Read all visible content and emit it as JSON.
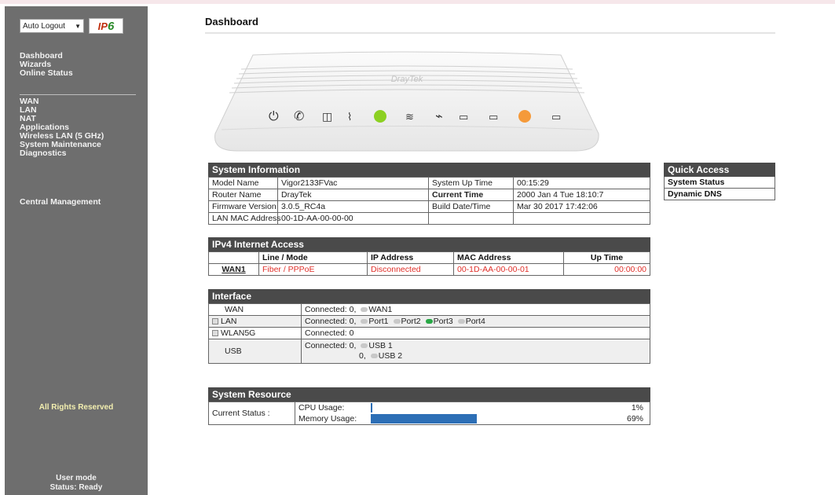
{
  "sidebar": {
    "logout_select": "Auto Logout",
    "ipv6_button": {
      "prefix": "IP",
      "suffix": "6"
    },
    "menu_group1": [
      "Dashboard",
      "Wizards",
      "Online Status"
    ],
    "menu_group2": [
      "WAN",
      "LAN",
      "NAT",
      "Applications",
      "Wireless LAN (5 GHz)",
      "System Maintenance",
      "Diagnostics"
    ],
    "central_management": "Central Management",
    "rights": "All Rights Reserved",
    "user_mode": "User mode",
    "status": "Status: Ready"
  },
  "page_title": "Dashboard",
  "router": {
    "brand_text": "DrayTek"
  },
  "system_info": {
    "title": "System Information",
    "rows": [
      [
        "Model Name",
        "Vigor2133FVac",
        "System Up Time",
        "00:15:29"
      ],
      [
        "Router Name",
        "DrayTek",
        "Current Time",
        "2000 Jan 4 Tue 18:10:7"
      ],
      [
        "Firmware Version",
        "3.0.5_RC4a",
        "Build Date/Time",
        "Mar 30 2017 17:42:06"
      ],
      [
        "LAN MAC Address",
        "00-1D-AA-00-00-00",
        "",
        ""
      ]
    ]
  },
  "quick_access": {
    "title": "Quick Access",
    "items": [
      "System Status",
      "Dynamic DNS"
    ]
  },
  "ipv4": {
    "title": "IPv4 Internet Access",
    "headers": [
      "",
      "Line / Mode",
      "IP Address",
      "MAC Address",
      "Up Time"
    ],
    "row": [
      "WAN1",
      "Fiber / PPPoE",
      "Disconnected",
      "00-1D-AA-00-00-01",
      "00:00:00"
    ]
  },
  "interface": {
    "title": "Interface",
    "wan": {
      "label": "WAN",
      "connected": "Connected: 0,",
      "ports": [
        "WAN1"
      ]
    },
    "lan": {
      "label": "LAN",
      "connected": "Connected: 0,",
      "ports": [
        "Port1",
        "Port2",
        "Port3",
        "Port4"
      ]
    },
    "wlan": {
      "label": "WLAN5G",
      "connected": "Connected: 0"
    },
    "usb": {
      "label": "USB",
      "connected": "Connected: 0,",
      "second": "0,",
      "ports": [
        "USB 1",
        "USB 2"
      ]
    }
  },
  "resource": {
    "title": "System Resource",
    "label": "Current Status :",
    "cpu_label": "CPU Usage:",
    "cpu_value": "1%",
    "cpu_fraction": 0.01,
    "mem_label": "Memory Usage:",
    "mem_value": "69%",
    "mem_fraction": 0.69
  },
  "colors": {
    "sidebar_bg": "#6e6e6e",
    "panel_header": "#4a4a4a",
    "bar_fill": "#2d6fb6",
    "alert_red": "#e0302a",
    "port_up": "#29a846"
  }
}
